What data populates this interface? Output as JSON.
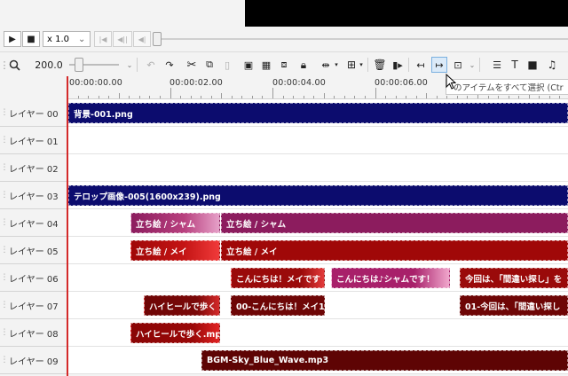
{
  "playback": {
    "speed_label": "x 1.0",
    "speed_chevron": "⌄",
    "play_glyph": "▶",
    "stop_glyph": "■",
    "first_glyph": "|◀",
    "prev_glyph": "◀||",
    "step_glyph": "◀|"
  },
  "toolbar": {
    "zoom_value": "200.0",
    "zoom_icon": "magnifier-icon"
  },
  "ruler": {
    "labels": [
      "00:00:00.00",
      "00:00:02.00",
      "00:00:04.00",
      "00:00:06.00"
    ]
  },
  "tooltip": {
    "text": "のアイテムをすべて選択 (Ctr"
  },
  "layers": [
    {
      "name": "レイヤー 00"
    },
    {
      "name": "レイヤー 01"
    },
    {
      "name": "レイヤー 02"
    },
    {
      "name": "レイヤー 03"
    },
    {
      "name": "レイヤー 04"
    },
    {
      "name": "レイヤー 05"
    },
    {
      "name": "レイヤー 06"
    },
    {
      "name": "レイヤー 07"
    },
    {
      "name": "レイヤー 08"
    },
    {
      "name": "レイヤー 09"
    }
  ],
  "clips": {
    "c00": "背景-001.png",
    "c03": "テロップ画像-005(1600x239).png",
    "c04a": "立ち絵 / シャム",
    "c04b": "立ち絵 / シャム",
    "c05a": "立ち絵 / メイ",
    "c05b": "立ち絵 / メイ",
    "c06a": "こんにちは！メイです",
    "c06b": "こんにちは♪シャムです！",
    "c06c": "今回は、「間違い探し」を",
    "c07a": "ハイヒールで歩く",
    "c07b": "00-こんにちは！メイ1",
    "c07c": "01-今回は、「間違い探し",
    "c08a": "ハイヒールで歩く.mp",
    "c09a": "BGM-Sky_Blue_Wave.mp3"
  },
  "colors": {
    "image_clip": "#0c0c6e",
    "shamu_clip": "#8c1c5e",
    "mei_clip": "#a00808",
    "text_clip": "#9a0a0a",
    "text_clip_pink": "#a8206a",
    "voice_clip": "#6e0606",
    "bgm_clip": "#5e0404",
    "playhead": "#d42a2a"
  }
}
